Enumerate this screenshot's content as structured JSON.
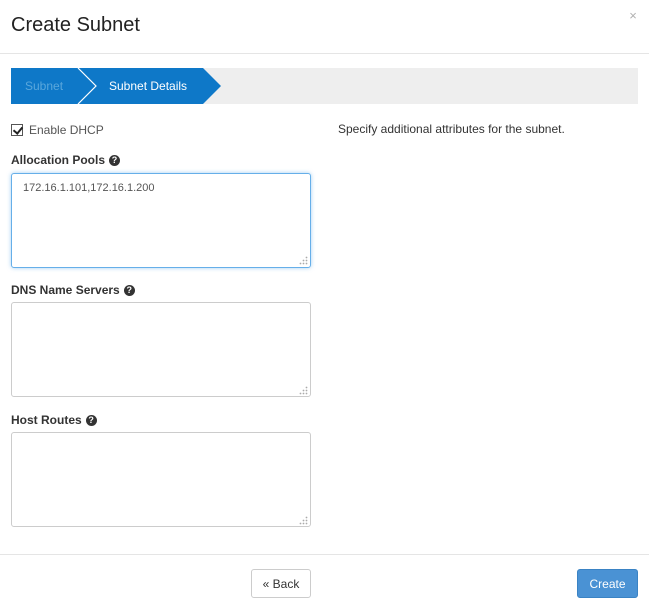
{
  "dialog": {
    "title": "Create Subnet",
    "close_glyph": "×"
  },
  "wizard": {
    "steps": [
      {
        "label": "Subnet",
        "state": "completed"
      },
      {
        "label": "Subnet Details",
        "state": "active"
      }
    ],
    "active_color": "#0e78c8",
    "track_color": "#eeeeee"
  },
  "form": {
    "enable_dhcp": {
      "label": "Enable DHCP",
      "checked": true
    },
    "allocation_pools": {
      "label": "Allocation Pools",
      "value": "172.16.1.101,172.16.1.200",
      "help_icon": "question-circle-icon"
    },
    "dns_name_servers": {
      "label": "DNS Name Servers",
      "value": "",
      "help_icon": "question-circle-icon"
    },
    "host_routes": {
      "label": "Host Routes",
      "value": "",
      "help_icon": "question-circle-icon"
    }
  },
  "help_text": "Specify additional attributes for the subnet.",
  "footer": {
    "back_label": "« Back",
    "create_label": "Create",
    "create_color": "#4a92d4"
  }
}
